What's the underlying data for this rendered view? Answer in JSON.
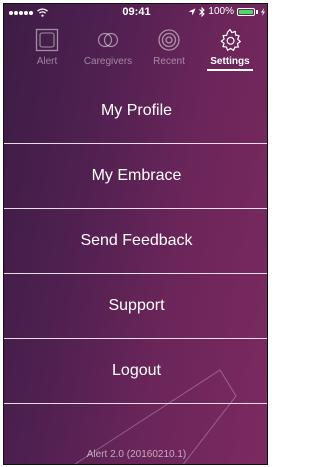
{
  "status_bar": {
    "time": "09:41",
    "battery": "100%",
    "battery_level": 1.0
  },
  "tabs": [
    {
      "label": "Alert",
      "icon": "alert-square-icon",
      "active": false
    },
    {
      "label": "Caregivers",
      "icon": "caregivers-circles-icon",
      "active": false
    },
    {
      "label": "Recent",
      "icon": "recent-ring-icon",
      "active": false
    },
    {
      "label": "Settings",
      "icon": "gear-icon",
      "active": true
    }
  ],
  "menu": {
    "items": [
      {
        "label": "My Profile"
      },
      {
        "label": "My Embrace"
      },
      {
        "label": "Send Feedback"
      },
      {
        "label": "Support"
      },
      {
        "label": "Logout"
      }
    ]
  },
  "footer": {
    "version": "Alert 2.0 (20160210.1)"
  },
  "colors": {
    "background_start": "#3c1d44",
    "background_end": "#7c2a60",
    "text": "#ffffff",
    "battery": "#4cd964"
  }
}
